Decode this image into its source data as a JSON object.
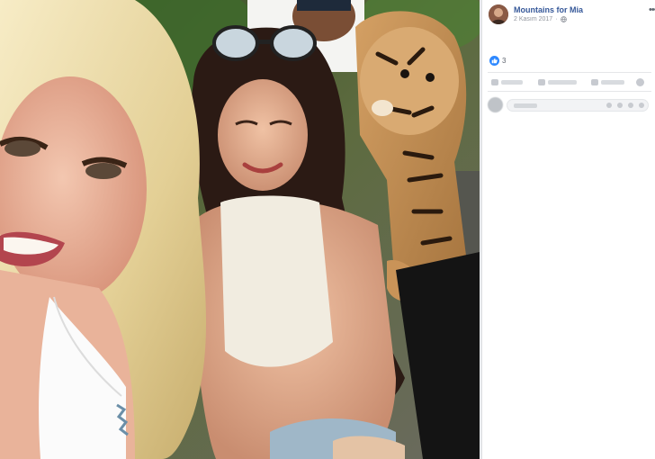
{
  "post": {
    "page_name": "Mountains for Mia",
    "date": "2 Kasım 2017",
    "privacy_icon": "globe-icon",
    "more_icon": "ellipsis-icon"
  },
  "reactions": {
    "icon": "like-icon",
    "count": "3"
  },
  "colors": {
    "link": "#365899",
    "like_blue": "#2d88ff",
    "meta_gray": "#90949c"
  }
}
